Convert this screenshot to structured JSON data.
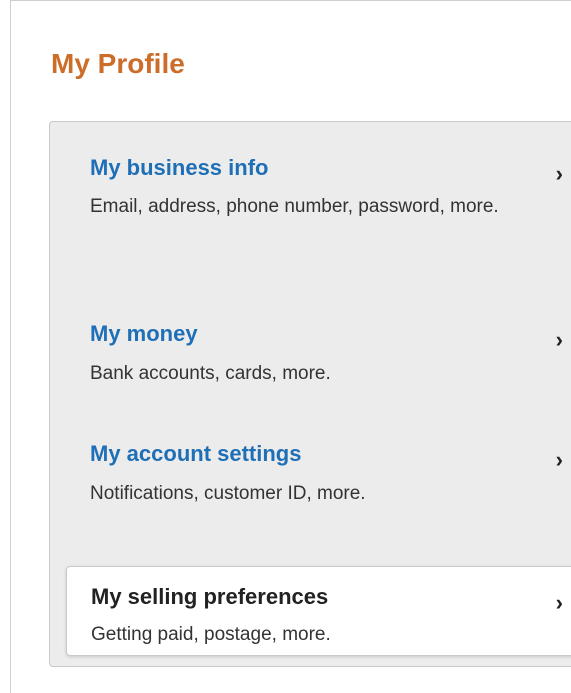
{
  "page": {
    "title": "My Profile"
  },
  "menu": {
    "items": [
      {
        "title": "My business info",
        "description": "Email, address, phone number, password, more.",
        "chevron": "›"
      },
      {
        "title": "My money",
        "description": "Bank accounts, cards, more.",
        "chevron": "›"
      },
      {
        "title": "My account settings",
        "description": "Notifications, customer ID, more.",
        "chevron": "›"
      },
      {
        "title": "My selling preferences",
        "description": "Getting paid, postage, more.",
        "chevron": "›",
        "selected": true
      }
    ]
  },
  "colors": {
    "title_orange": "#cc6d2a",
    "link_blue": "#1f6fb7",
    "panel_bg": "#ececec",
    "selected_bg": "#ffffff"
  }
}
